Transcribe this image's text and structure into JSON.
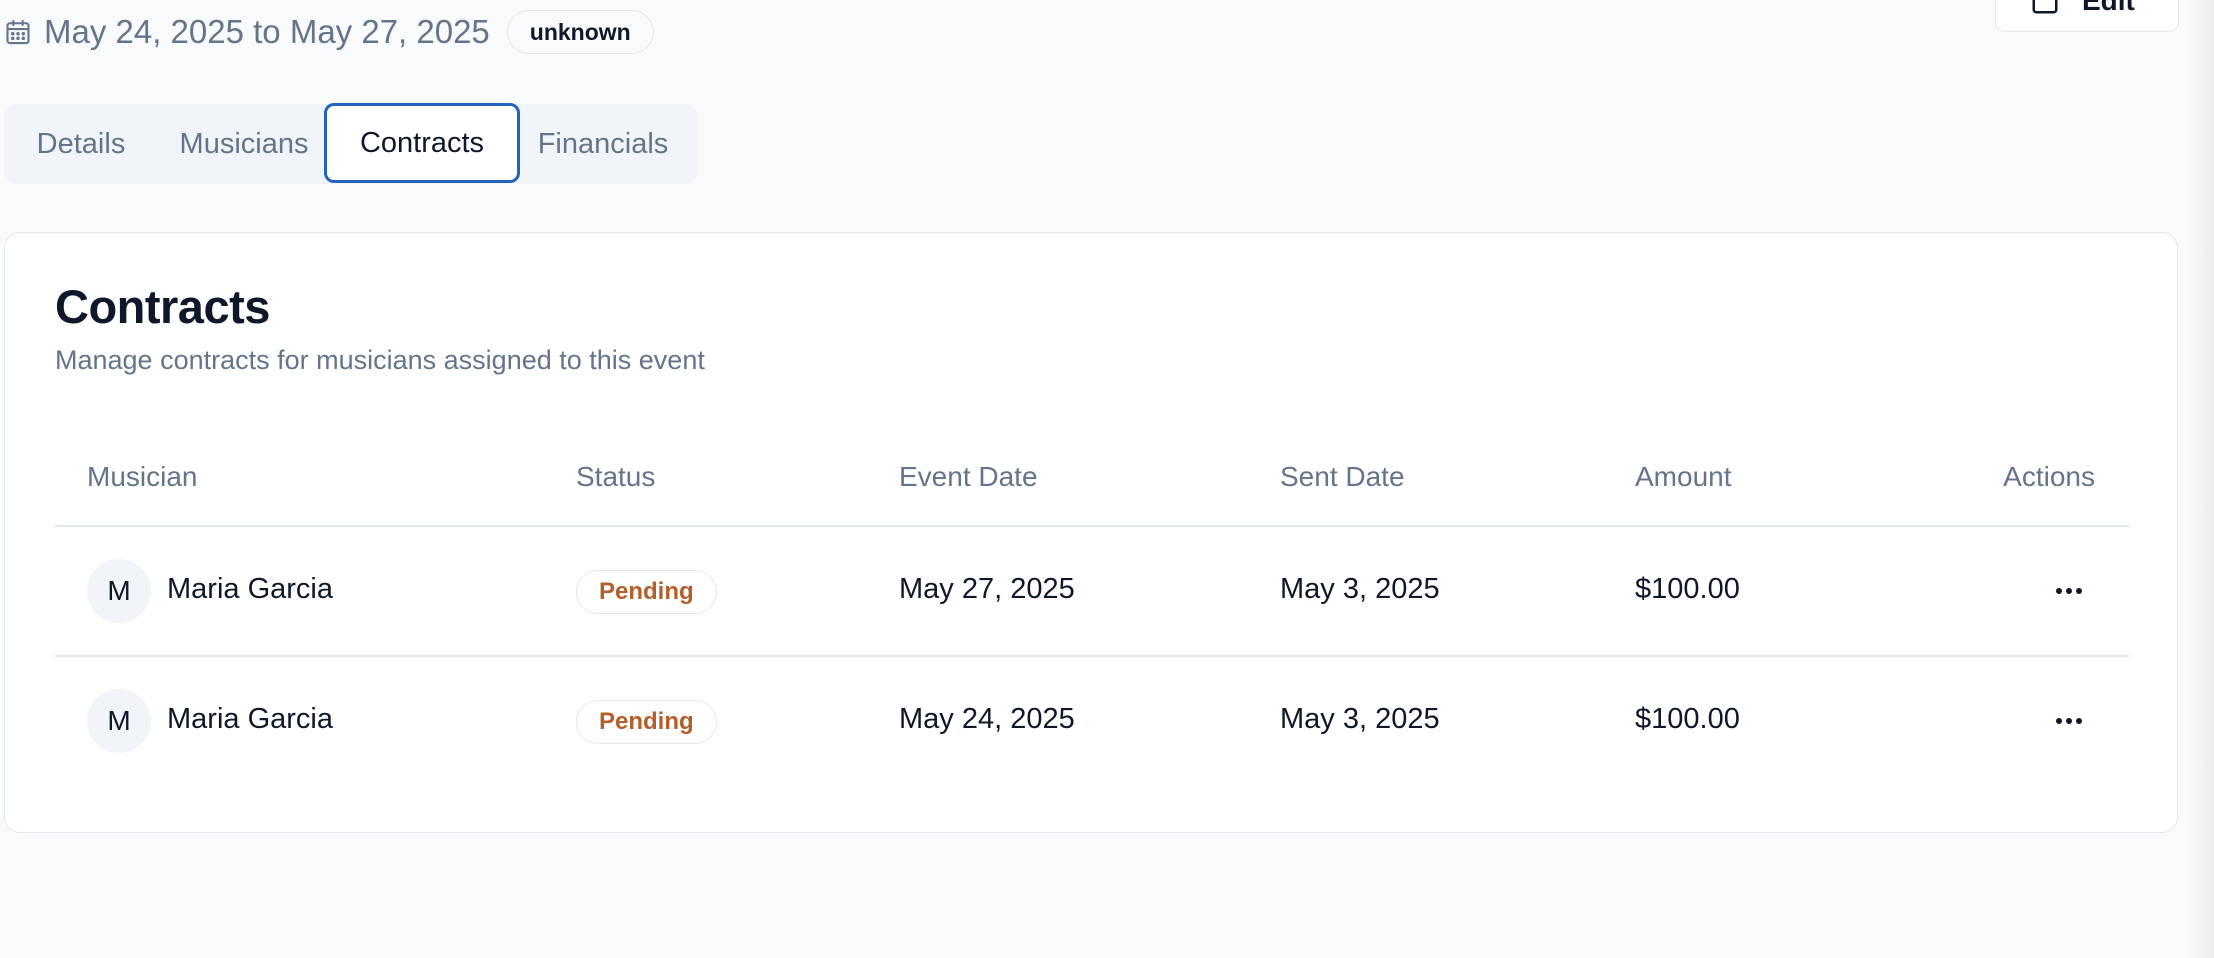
{
  "header": {
    "date_range": "May 24, 2025 to May 27, 2025",
    "status_badge": "unknown",
    "edit_label": "Edit"
  },
  "tabs": [
    {
      "label": "Details"
    },
    {
      "label": "Musicians"
    },
    {
      "label": "Contracts",
      "active": true
    },
    {
      "label": "Financials"
    }
  ],
  "card": {
    "title": "Contracts",
    "subtitle": "Manage contracts for musicians assigned to this event"
  },
  "table": {
    "columns": [
      "Musician",
      "Status",
      "Event Date",
      "Sent Date",
      "Amount",
      "Actions"
    ],
    "rows": [
      {
        "avatar": "M",
        "musician": "Maria Garcia",
        "status": "Pending",
        "event_date": "May 27, 2025",
        "sent_date": "May 3, 2025",
        "amount": "$100.00"
      },
      {
        "avatar": "M",
        "musician": "Maria Garcia",
        "status": "Pending",
        "event_date": "May 24, 2025",
        "sent_date": "May 3, 2025",
        "amount": "$100.00"
      }
    ]
  },
  "icons": {
    "calendar": "calendar-icon",
    "edit": "edit-icon",
    "more": "more-horizontal-icon"
  },
  "colors": {
    "active_tab_border": "#2563b8",
    "pending": "#b45f2a",
    "muted_text": "#64748b"
  }
}
